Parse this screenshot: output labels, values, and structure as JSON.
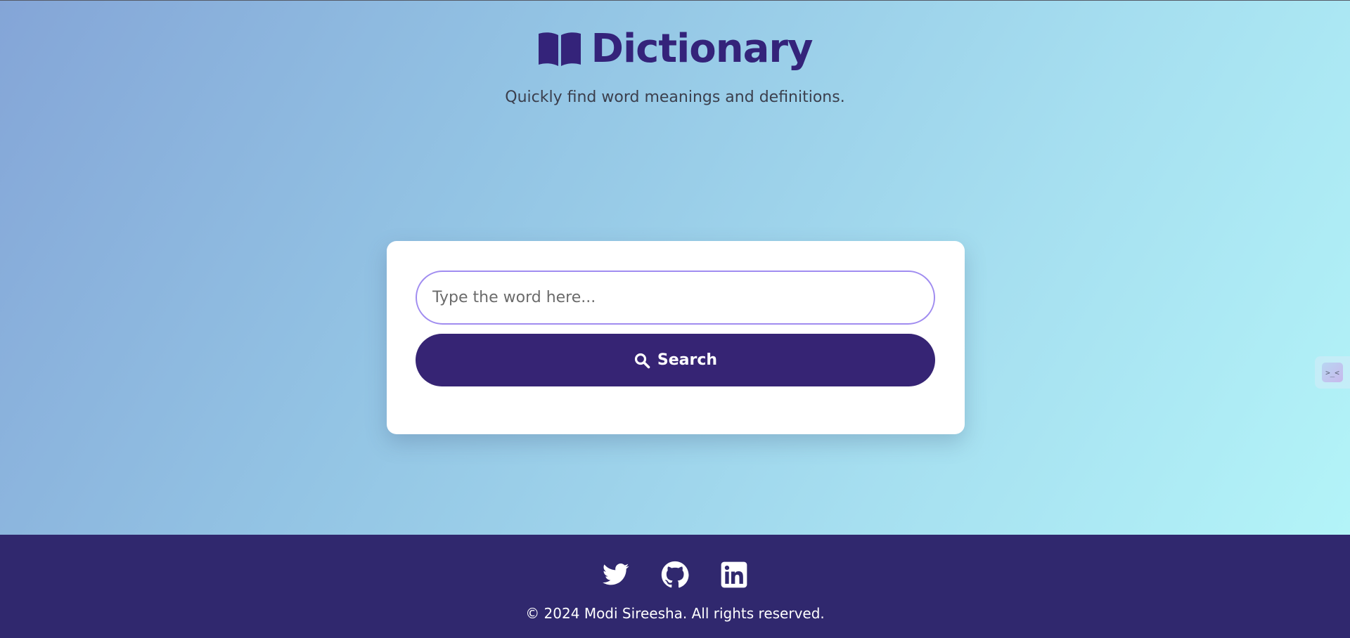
{
  "header": {
    "title": "Dictionary",
    "subtitle": "Quickly find word meanings and definitions.",
    "icon": "book-open-icon"
  },
  "search": {
    "placeholder": "Type the word here...",
    "value": "",
    "button_label": "Search",
    "button_icon": "search-icon"
  },
  "footer": {
    "social": [
      {
        "name": "twitter-icon"
      },
      {
        "name": "github-icon"
      },
      {
        "name": "linkedin-icon"
      }
    ],
    "copyright": "© 2024 Modi Sireesha. All rights reserved."
  },
  "colors": {
    "brand": "#34237a",
    "button": "#362474",
    "footer": "#30286e",
    "input_border": "#a08cf0",
    "gradient_start": "#84a5d7",
    "gradient_end": "#b3f4f8"
  }
}
